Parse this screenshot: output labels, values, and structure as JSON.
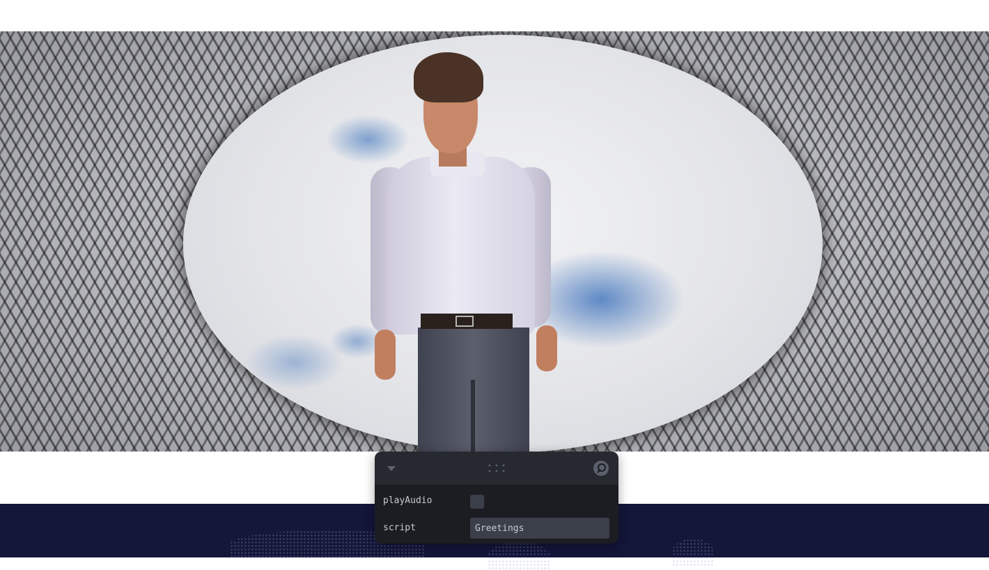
{
  "scene": {
    "background": "stadium-facade-with-sky-opening",
    "character": "standing-avatar-white-shirt"
  },
  "gui": {
    "collapse_icon": "triangle-down-icon",
    "drag_icon": "drag-dots-icon",
    "search_icon": "search-icon",
    "controls": [
      {
        "label": "playAudio",
        "type": "checkbox",
        "checked": false
      },
      {
        "label": "script",
        "type": "text",
        "value": "Greetings"
      }
    ]
  },
  "colors": {
    "panel_bg": "#1b1d22",
    "panel_titlebar": "#262930",
    "control_bg": "#3b3f4a",
    "label_text": "#c8cbd3",
    "footer_bg": "#14163a"
  }
}
